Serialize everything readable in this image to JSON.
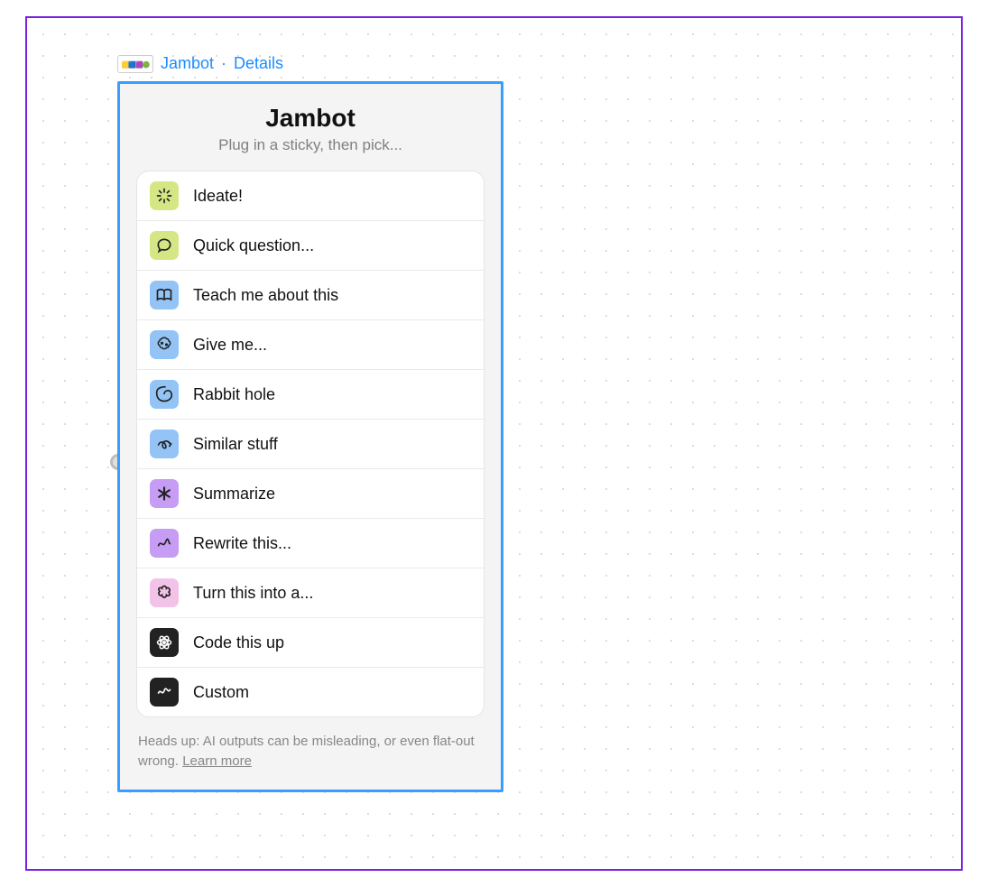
{
  "breadcrumb": {
    "widget_name": "Jambot",
    "separator": "·",
    "details": "Details"
  },
  "panel": {
    "title": "Jambot",
    "subtitle": "Plug in a sticky, then pick...",
    "actions": [
      {
        "id": "ideate",
        "label": "Ideate!",
        "icon": "burst-icon",
        "color": "green"
      },
      {
        "id": "quick-question",
        "label": "Quick question...",
        "icon": "speech-icon",
        "color": "green"
      },
      {
        "id": "teach",
        "label": "Teach me about this",
        "icon": "book-icon",
        "color": "blue"
      },
      {
        "id": "give-me",
        "label": "Give me...",
        "icon": "brain-icon",
        "color": "blue"
      },
      {
        "id": "rabbit-hole",
        "label": "Rabbit hole",
        "icon": "spiral-icon",
        "color": "blue"
      },
      {
        "id": "similar",
        "label": "Similar stuff",
        "icon": "loop-icon",
        "color": "blue"
      },
      {
        "id": "summarize",
        "label": "Summarize",
        "icon": "asterisk-icon",
        "color": "purple"
      },
      {
        "id": "rewrite",
        "label": "Rewrite this...",
        "icon": "squiggle-icon",
        "color": "purple"
      },
      {
        "id": "turn-into",
        "label": "Turn this into a...",
        "icon": "flower-icon",
        "color": "pink"
      },
      {
        "id": "code",
        "label": "Code this up",
        "icon": "atom-icon",
        "color": "black"
      },
      {
        "id": "custom",
        "label": "Custom",
        "icon": "scribble-icon",
        "color": "black"
      }
    ],
    "footer_text": "Heads up: AI outputs can be misleading, or even flat-out wrong. ",
    "footer_link": "Learn more"
  }
}
